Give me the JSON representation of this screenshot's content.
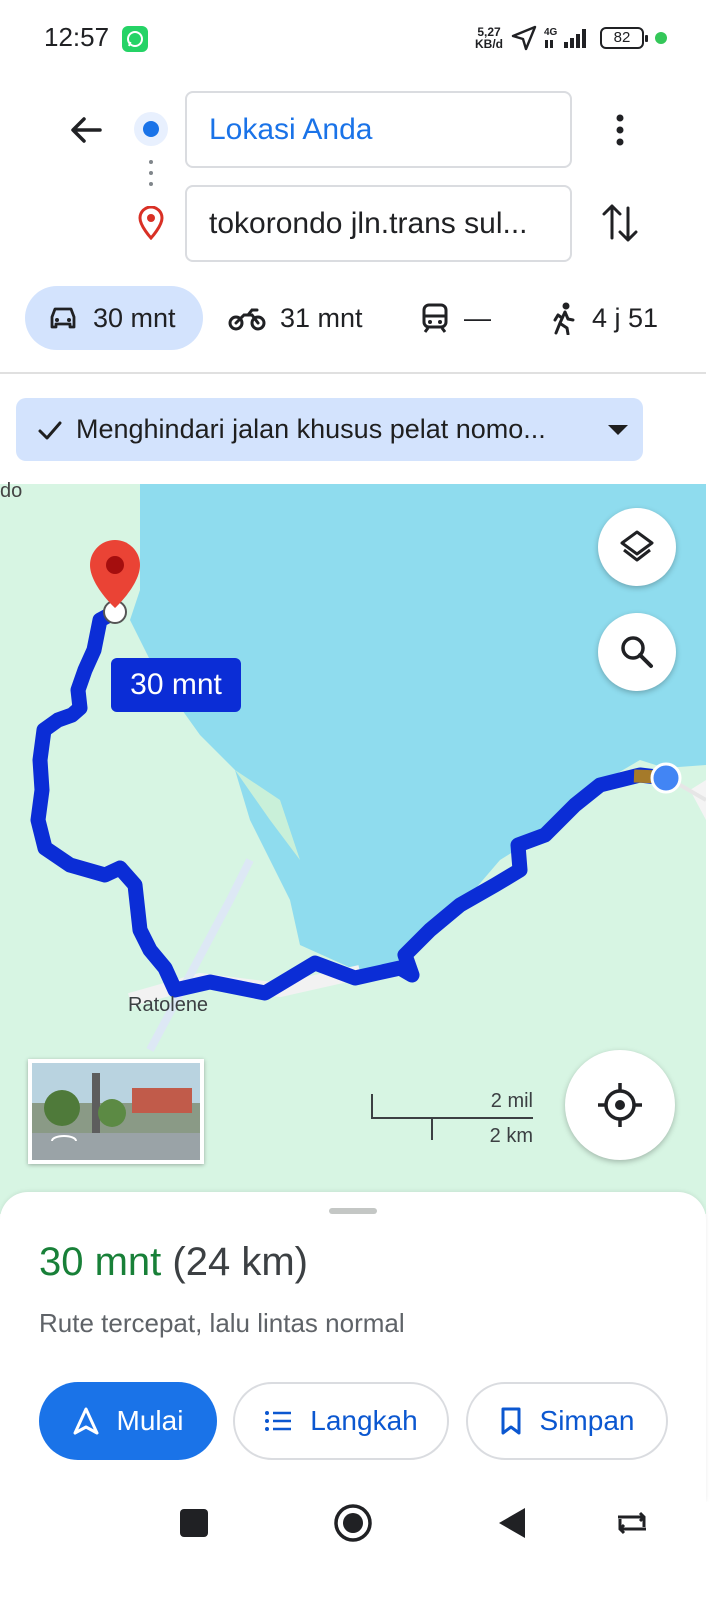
{
  "status_bar": {
    "time": "12:57",
    "net_speed_value": "5,27",
    "net_speed_unit": "KB/d",
    "network": "4G",
    "battery": "82",
    "icons": [
      "whatsapp-icon",
      "location-arrow-icon",
      "signal-icon",
      "battery-icon"
    ]
  },
  "route_header": {
    "origin": "Lokasi Anda",
    "destination": "tokorondo jln.trans sul...",
    "icons": [
      "back-arrow-icon",
      "more-vert-icon",
      "swap-icon"
    ]
  },
  "travel_modes": [
    {
      "mode": "car",
      "label": "30 mnt",
      "selected": true
    },
    {
      "mode": "motorcycle",
      "label": "31 mnt",
      "selected": false
    },
    {
      "mode": "transit",
      "label": "—",
      "selected": false
    },
    {
      "mode": "walk",
      "label": "4 j 51",
      "selected": false
    }
  ],
  "avoid_chip": {
    "label": "Menghindari jalan khusus pelat nomo..."
  },
  "map": {
    "place_label_partial": "do",
    "place_label": "Ratolene",
    "eta_badge": "30 mnt",
    "scale_miles": "2 mil",
    "scale_km": "2 km",
    "route_color": "#0b2dd6",
    "water_color": "#8fdcee",
    "land_color": "#d7f5e3"
  },
  "sheet": {
    "eta_time": "30 mnt",
    "eta_distance": "(24 km)",
    "description": "Rute tercepat, lalu lintas normal",
    "buttons": {
      "start": "Mulai",
      "steps": "Langkah",
      "save": "Simpan"
    }
  },
  "colors": {
    "accent": "#1a73e8",
    "eta_green": "#188038",
    "chip_bg": "#d3e3fd"
  }
}
